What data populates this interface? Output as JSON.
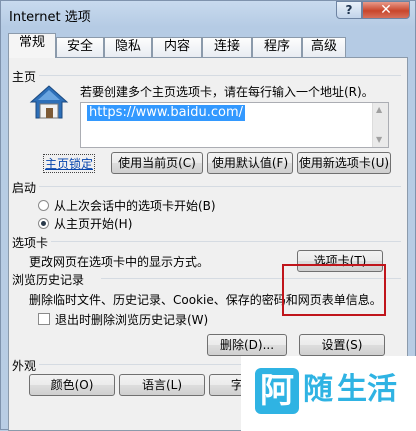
{
  "window": {
    "title": "Internet 选项",
    "help_label": "?",
    "close_label": "✕"
  },
  "tabs": [
    {
      "label": "常规"
    },
    {
      "label": "安全"
    },
    {
      "label": "隐私"
    },
    {
      "label": "内容"
    },
    {
      "label": "连接"
    },
    {
      "label": "程序"
    },
    {
      "label": "高级"
    }
  ],
  "home": {
    "section_label": "主页",
    "icon": "house-icon",
    "description": "若要创建多个主页选项卡，请在每行输入一个地址(R)。",
    "url_value": "https://www.baidu.com/",
    "lock_link": "主页锁定",
    "use_current": "使用当前页(C)",
    "use_default": "使用默认值(F)",
    "use_new_tab": "使用新选项卡(U)"
  },
  "startup": {
    "section_label": "启动",
    "option_last_session": "从上次会话中的选项卡开始(B)",
    "option_home": "从主页开始(H)",
    "selected": "option_home"
  },
  "tabs_section": {
    "section_label": "选项卡",
    "description": "更改网页在选项卡中的显示方式。",
    "button": "选项卡(T)"
  },
  "history": {
    "section_label": "浏览历史记录",
    "description": "删除临时文件、历史记录、Cookie、保存的密码和网页表单信息。",
    "delete_on_exit": "退出时删除浏览历史记录(W)",
    "delete_on_exit_checked": false,
    "delete_button": "删除(D)...",
    "settings_button": "设置(S)"
  },
  "appearance": {
    "section_label": "外观",
    "colors_button": "颜色(O)",
    "languages_button": "语言(L)",
    "fonts_button": "字体(N)"
  },
  "watermark": {
    "icon_glyph": "阿",
    "text_1": "随",
    "text_2": "生活"
  },
  "colors": {
    "accent_red": "#c0151b",
    "selection_blue": "#3399ff",
    "watermark_blue": "#2fb3e3"
  }
}
